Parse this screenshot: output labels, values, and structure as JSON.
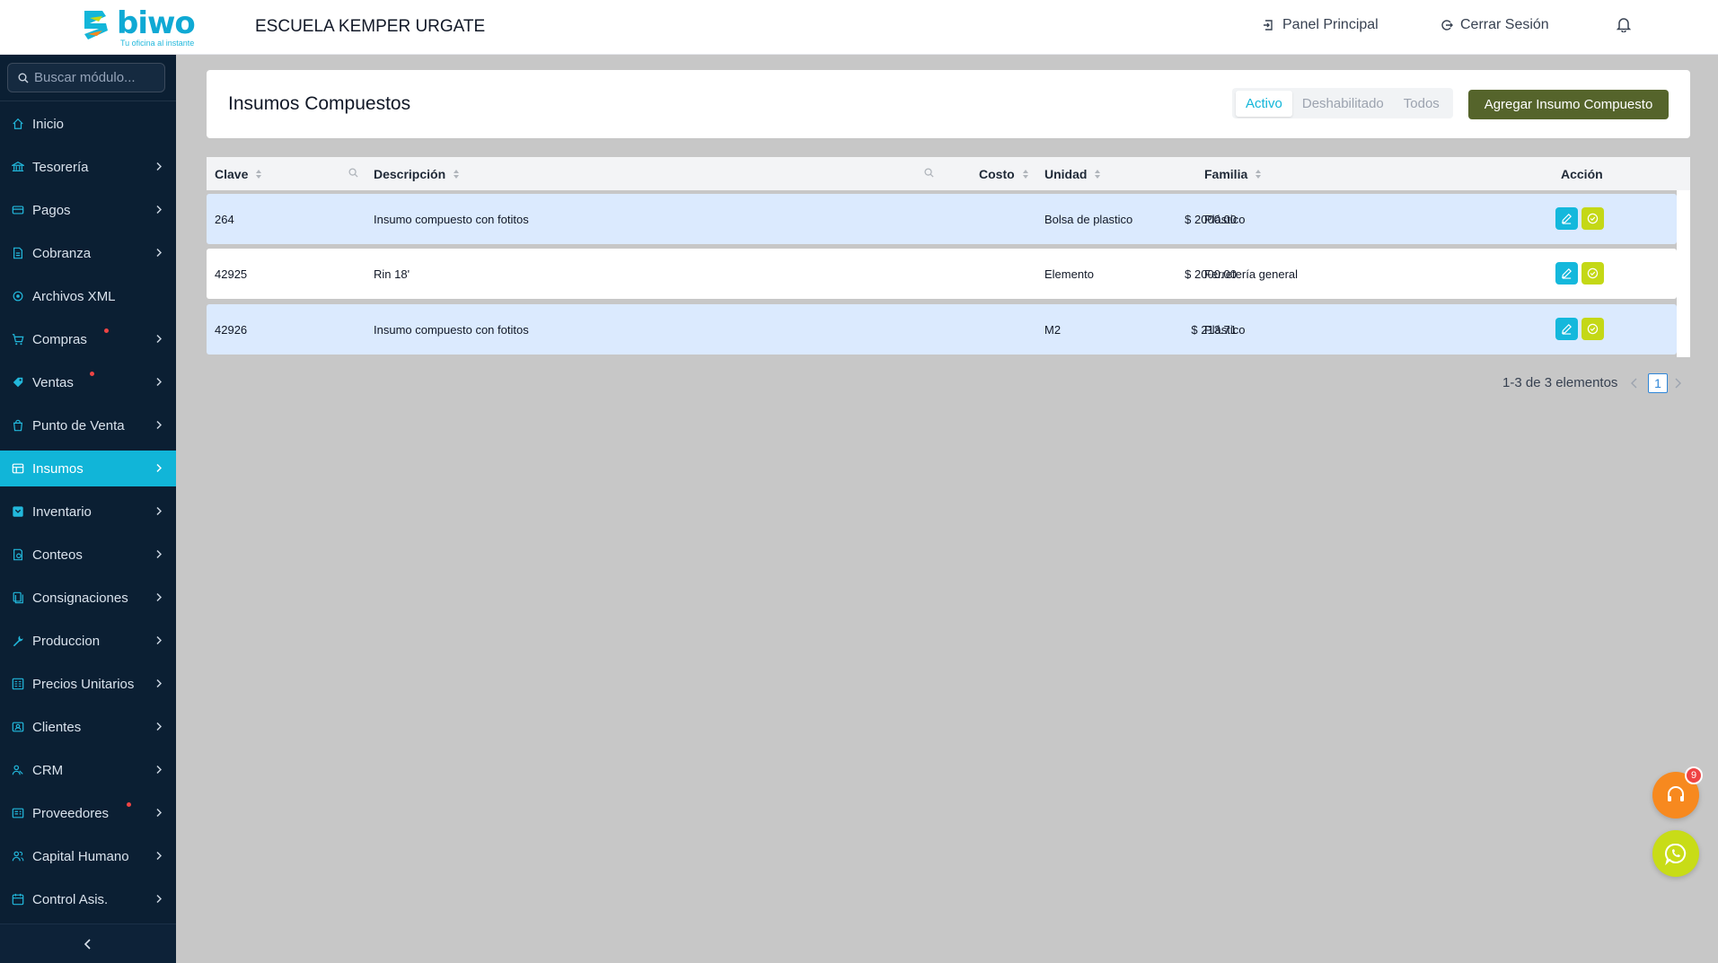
{
  "brand": {
    "name": "biwo",
    "tagline": "Tu oficina al instante"
  },
  "header": {
    "school": "ESCUELA KEMPER URGATE",
    "panel_label": "Panel Principal",
    "logout_label": "Cerrar Sesión"
  },
  "sidebar": {
    "search_placeholder": "Buscar módulo...",
    "items": [
      {
        "label": "Inicio",
        "icon": "home-icon",
        "chevron": false
      },
      {
        "label": "Tesorería",
        "icon": "bank-icon",
        "chevron": true
      },
      {
        "label": "Pagos",
        "icon": "payments-icon",
        "chevron": true
      },
      {
        "label": "Cobranza",
        "icon": "document-icon",
        "chevron": true
      },
      {
        "label": "Archivos XML",
        "icon": "xml-icon",
        "chevron": false
      },
      {
        "label": "Compras",
        "icon": "cart-icon",
        "chevron": true,
        "dot": true
      },
      {
        "label": "Ventas",
        "icon": "tag-icon",
        "chevron": true,
        "dot": true
      },
      {
        "label": "Punto de Venta",
        "icon": "bag-icon",
        "chevron": true
      },
      {
        "label": "Insumos",
        "icon": "grid-icon",
        "chevron": true,
        "active": true
      },
      {
        "label": "Inventario",
        "icon": "inventory-icon",
        "chevron": true
      },
      {
        "label": "Conteos",
        "icon": "count-icon",
        "chevron": true
      },
      {
        "label": "Consignaciones",
        "icon": "consign-icon",
        "chevron": true
      },
      {
        "label": "Produccion",
        "icon": "wrench-icon",
        "chevron": true
      },
      {
        "label": "Precios Unitarios",
        "icon": "price-icon",
        "chevron": true
      },
      {
        "label": "Clientes",
        "icon": "clients-icon",
        "chevron": true
      },
      {
        "label": "CRM",
        "icon": "crm-icon",
        "chevron": true
      },
      {
        "label": "Proveedores",
        "icon": "suppliers-icon",
        "chevron": true,
        "dot": true
      },
      {
        "label": "Capital Humano",
        "icon": "people-icon",
        "chevron": true
      },
      {
        "label": "Control Asis.",
        "icon": "calendar-icon",
        "chevron": true
      }
    ]
  },
  "main": {
    "title": "Insumos Compuestos",
    "filters": [
      "Activo",
      "Deshabilitado",
      "Todos"
    ],
    "active_filter": "Activo",
    "add_label": "Agregar Insumo Compuesto",
    "columns": {
      "clave": "Clave",
      "descripcion": "Descripción",
      "costo": "Costo",
      "unidad": "Unidad",
      "familia": "Familia",
      "accion": "Acción"
    },
    "rows": [
      {
        "clave": "264",
        "descripcion": "Insumo compuesto con fotitos",
        "costo": "$ 2000.00",
        "unidad": "Bolsa de plastico",
        "familia": "Plástico"
      },
      {
        "clave": "42925",
        "descripcion": "Rin 18'",
        "costo": "$ 2000.00",
        "unidad": "Elemento",
        "familia": "Ferretería general"
      },
      {
        "clave": "42926",
        "descripcion": "Insumo compuesto con fotitos",
        "costo": "$ 213.71",
        "unidad": "M2",
        "familia": "Plástico"
      }
    ],
    "pagination": {
      "summary": "1-3 de 3 elementos",
      "page": "1"
    }
  },
  "support": {
    "badge": "9"
  },
  "colors": {
    "accent": "#11b5d8",
    "sidebar": "#0b1f33",
    "add_button": "#55642b",
    "action_ok": "#c4d816",
    "support": "#f7891f"
  }
}
